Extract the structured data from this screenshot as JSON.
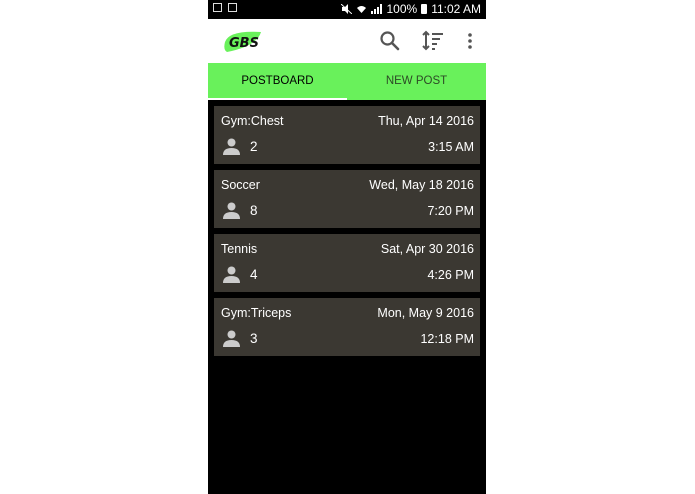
{
  "status_bar": {
    "battery": "100%",
    "time": "11:02 AM"
  },
  "app_bar": {
    "logo_text": "GBS",
    "icons": [
      "search-icon",
      "sort-icon",
      "more-vert-icon"
    ]
  },
  "tabs": [
    {
      "label": "POSTBOARD",
      "active": true
    },
    {
      "label": "NEW POST",
      "active": false
    }
  ],
  "posts": [
    {
      "name": "Gym:Chest",
      "date": "Thu, Apr 14 2016",
      "count": "2",
      "time": "3:15 AM"
    },
    {
      "name": "Soccer",
      "date": "Wed, May 18 2016",
      "count": "8",
      "time": "7:20 PM"
    },
    {
      "name": "Tennis",
      "date": "Sat, Apr 30 2016",
      "count": "4",
      "time": "4:26 PM"
    },
    {
      "name": "Gym:Triceps",
      "date": "Mon, May 9 2016",
      "count": "3",
      "time": "12:18 PM"
    }
  ],
  "colors": {
    "accent": "#69f15b",
    "card": "#3b3832",
    "background": "#000000"
  }
}
